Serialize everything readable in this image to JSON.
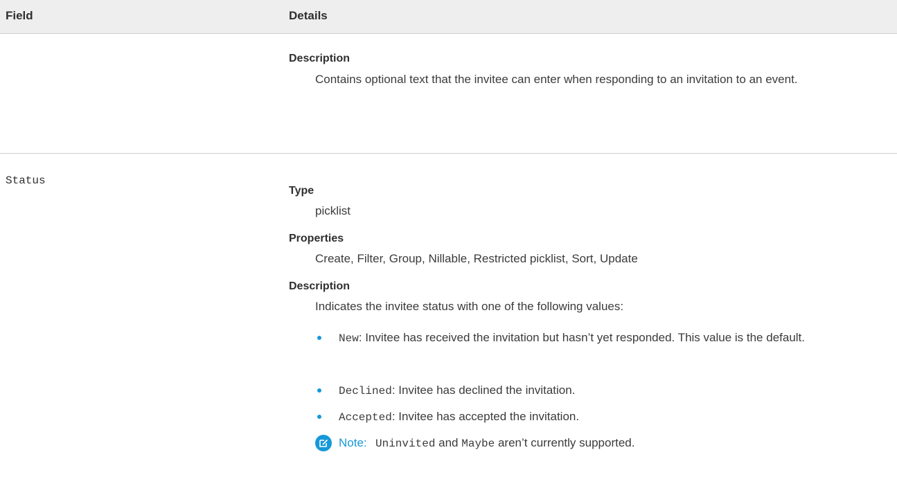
{
  "table": {
    "header": {
      "field": "Field",
      "details": "Details"
    },
    "rows": [
      {
        "field": "",
        "description_label": "Description",
        "description_text": "Contains optional text that the invitee can enter when responding to an invitation to an event."
      },
      {
        "field": "Status",
        "type_label": "Type",
        "type_value": "picklist",
        "properties_label": "Properties",
        "properties_value": "Create, Filter, Group, Nillable, Restricted picklist, Sort, Update",
        "description_label": "Description",
        "description_intro": "Indicates the invitee status with one of the following values:",
        "values": [
          {
            "code": "New",
            "text": ": Invitee has received the invitation but hasn’t yet responded. This value is the default."
          },
          {
            "code": "Declined",
            "text": ": Invitee has declined the invitation."
          },
          {
            "code": "Accepted",
            "text": ": Invitee has accepted the invitation."
          }
        ],
        "note": {
          "icon": "edit-note-icon",
          "label": "Note:",
          "code1": "Uninvited",
          "middle": " and ",
          "code2": "Maybe",
          "tail": " aren’t currently supported."
        }
      }
    ]
  },
  "colors": {
    "accent": "#1798d8",
    "header_bg": "#eeeeee",
    "text": "#3b3b3b"
  }
}
